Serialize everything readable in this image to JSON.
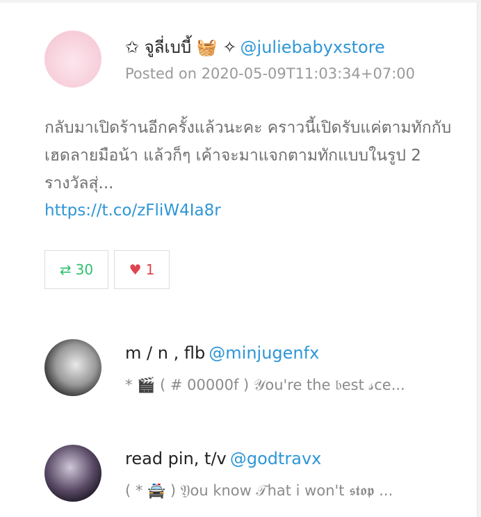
{
  "post": {
    "display_name": "✩ จูลี่เบบี้ 🧺 ✧",
    "handle": "@juliebabyxstore",
    "posted": "Posted on 2020-05-09T11:03:34+07:00",
    "text": "กลับมาเปิดร้านอีกครั้งแล้วนะคะ คราวนี้เปิดรับแค่ตามทักกับเฮดลายมือน้า แล้วก็ๆ เค้าจะมาแจกตามทักแบบในรูป 2 รางวัลสุ่...",
    "link": "https://t.co/zFliW4Ia8r",
    "retweet_count": "30",
    "like_count": "1",
    "retweet_icon": "⇄",
    "like_icon": "♥"
  },
  "replies": [
    {
      "display_name": "m / n , flb",
      "handle": "@minjugenfx",
      "snippet": "* 🎬 ( # 00000f ) 𝒴ou're the 𝔟est 𝓈ce..."
    },
    {
      "display_name": "read pin, t/v",
      "handle": "@godtravx",
      "snippet": "( * 🚔 ) 𝔜ou know 𝒯hat i won't 𝖘𝖙𝖔𝖕 ..."
    }
  ]
}
